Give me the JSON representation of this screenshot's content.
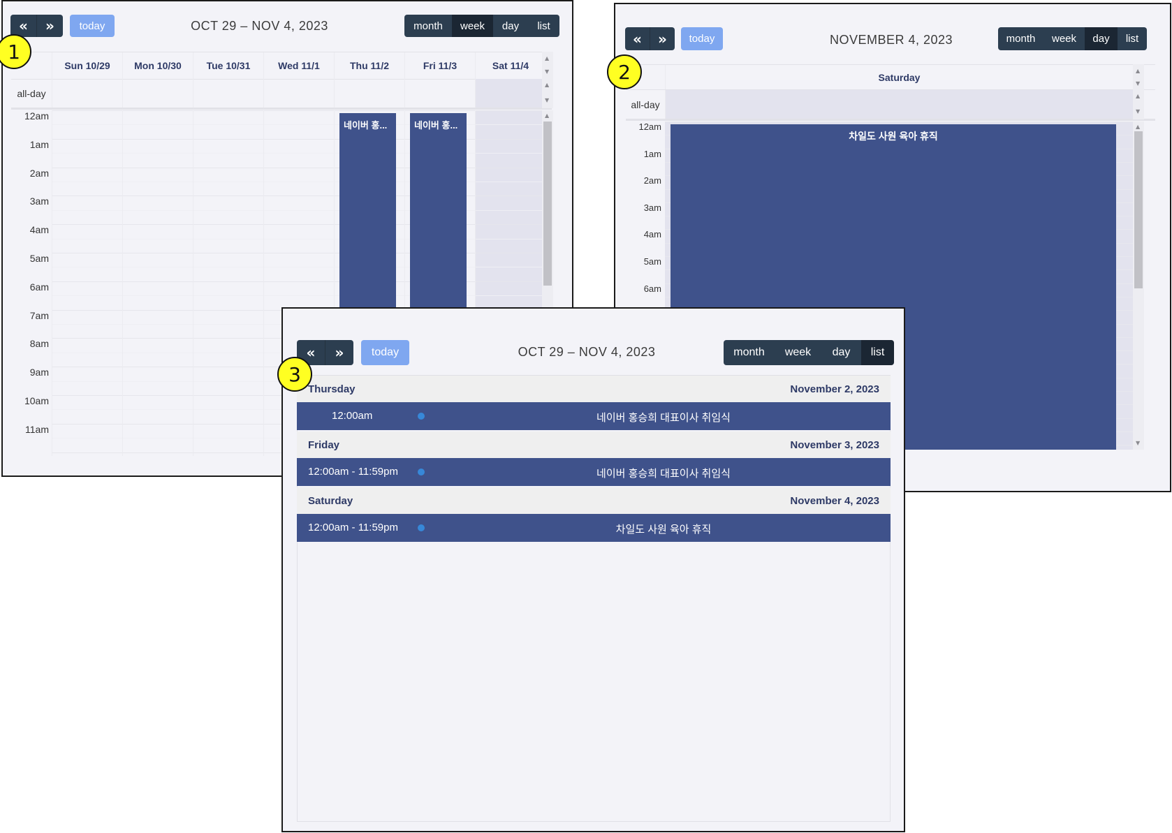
{
  "panel1": {
    "badge": "1",
    "prev_icon": "«",
    "next_icon": "»",
    "today_label": "today",
    "title": "OCT 29 – NOV 4, 2023",
    "views": [
      {
        "label": "month",
        "active": false
      },
      {
        "label": "week",
        "active": true
      },
      {
        "label": "day",
        "active": false
      },
      {
        "label": "list",
        "active": false
      }
    ],
    "columns": [
      "Sun 10/29",
      "Mon 10/30",
      "Tue 10/31",
      "Wed 11/1",
      "Thu 11/2",
      "Fri 11/3",
      "Sat 11/4"
    ],
    "allday_label": "all-day",
    "times": [
      "12am",
      "1am",
      "2am",
      "3am",
      "4am",
      "5am",
      "6am",
      "7am",
      "8am",
      "9am",
      "10am",
      "11am"
    ],
    "events": [
      {
        "title": "네이버 홍...",
        "day_index": 4
      },
      {
        "title": "네이버 홍...",
        "day_index": 5
      }
    ]
  },
  "panel2": {
    "badge": "2",
    "prev_icon": "«",
    "next_icon": "»",
    "today_label": "today",
    "title": "NOVEMBER 4, 2023",
    "views": [
      {
        "label": "month",
        "active": false
      },
      {
        "label": "week",
        "active": false
      },
      {
        "label": "day",
        "active": true
      },
      {
        "label": "list",
        "active": false
      }
    ],
    "column": "Saturday",
    "allday_label": "all-day",
    "times": [
      "12am",
      "1am",
      "2am",
      "3am",
      "4am",
      "5am",
      "6am"
    ],
    "event_title": "차일도 사원 육아 휴직"
  },
  "panel3": {
    "badge": "3",
    "prev_icon": "«",
    "next_icon": "»",
    "today_label": "today",
    "title": "OCT 29 – NOV 4, 2023",
    "views": [
      {
        "label": "month",
        "active": false
      },
      {
        "label": "week",
        "active": false
      },
      {
        "label": "day",
        "active": false
      },
      {
        "label": "list",
        "active": true
      }
    ],
    "days": [
      {
        "weekday": "Thursday",
        "date": "November 2, 2023",
        "time": "12:00am",
        "title": "네이버 홍승희 대표이사 취임식"
      },
      {
        "weekday": "Friday",
        "date": "November 3, 2023",
        "time": "12:00am - 11:59pm",
        "title": "네이버 홍승희 대표이사 취임식"
      },
      {
        "weekday": "Saturday",
        "date": "November 4, 2023",
        "time": "12:00am - 11:59pm",
        "title": "차일도 사원 육아 휴직"
      }
    ]
  },
  "colors": {
    "toolbar_button": "#2c3e50",
    "toolbar_button_active": "#1b2633",
    "today_button": "#7fa7f0",
    "event_fill": "#3f528b",
    "event_dot": "#3788d8",
    "badge": "#ffff22"
  }
}
